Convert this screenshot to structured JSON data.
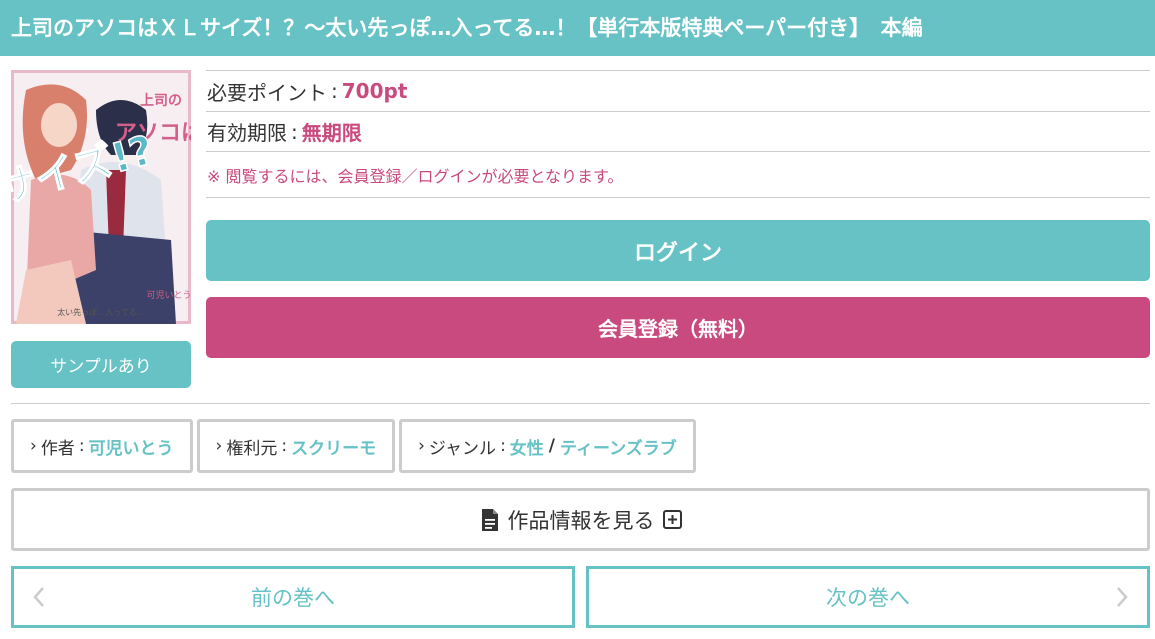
{
  "title": "上司のアソコはＸＬサイズ！？～太い先っぽ…入ってる…！【単行本版特典ペーパー付き】　本編",
  "cover": {
    "title_line1": "上司の",
    "title_line2": "アソコは",
    "title_line3": "XLサイズ!?",
    "subtitle": "太い先っぽ…入ってる…",
    "author": "可児いとう"
  },
  "sample_label": "サンプルあり",
  "points": {
    "label": "必要ポイント",
    "value": "700pt"
  },
  "expiry": {
    "label": "有効期限",
    "value": "無期限"
  },
  "notice": "※ 閲覧するには、会員登録／ログインが必要となります。",
  "login_label": "ログイン",
  "register_label": "会員登録（無料）",
  "meta": {
    "author_label": "作者",
    "author_value": "可児いとう",
    "publisher_label": "権利元",
    "publisher_value": "スクリーモ",
    "genre_label": "ジャンル",
    "genre_value1": "女性",
    "genre_value2": "ティーンズラブ"
  },
  "work_info_label": "作品情報を見る",
  "nav": {
    "prev_label": "前の巻へ",
    "next_label": "次の巻へ"
  },
  "colors": {
    "teal": "#66c2c5",
    "pink": "#c94a7e",
    "border": "#cccccc"
  },
  "icons": {
    "doc": "document-icon",
    "plus": "plus-square-icon",
    "prev": "chevron-left-icon",
    "next": "chevron-right-icon"
  }
}
